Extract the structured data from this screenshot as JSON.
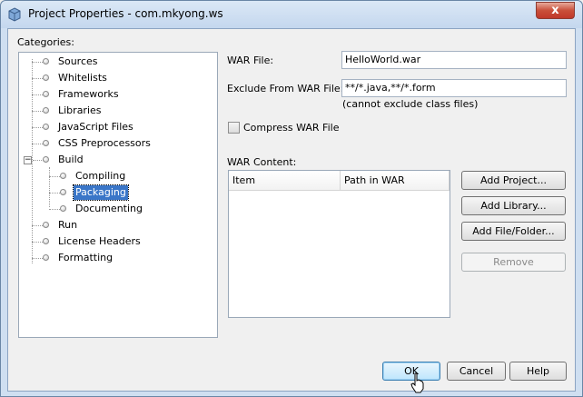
{
  "window": {
    "title": "Project Properties - com.mkyong.ws",
    "close_label": "x"
  },
  "categories": {
    "label": "Categories:",
    "items": [
      {
        "label": "Sources"
      },
      {
        "label": "Whitelists"
      },
      {
        "label": "Frameworks"
      },
      {
        "label": "Libraries"
      },
      {
        "label": "JavaScript Files"
      },
      {
        "label": "CSS Preprocessors"
      },
      {
        "label": "Build",
        "expander": "−"
      },
      {
        "label": "Compiling"
      },
      {
        "label": "Packaging"
      },
      {
        "label": "Documenting"
      },
      {
        "label": "Run"
      },
      {
        "label": "License Headers"
      },
      {
        "label": "Formatting"
      }
    ],
    "selected": "Packaging"
  },
  "form": {
    "war_file_label": "WAR File:",
    "war_file_value": "HelloWorld.war",
    "exclude_label": "Exclude From WAR File:",
    "exclude_value": "**/*.java,**/*.form",
    "exclude_hint": "(cannot exclude class files)",
    "compress_label": "Compress WAR File",
    "compress_checked": false,
    "war_content_label": "WAR Content:",
    "table_headers": [
      "Item",
      "Path in WAR"
    ]
  },
  "side_buttons": {
    "add_project": "Add Project...",
    "add_library": "Add Library...",
    "add_file_folder": "Add File/Folder...",
    "remove": "Remove"
  },
  "footer": {
    "ok": "OK",
    "cancel": "Cancel",
    "help": "Help"
  }
}
